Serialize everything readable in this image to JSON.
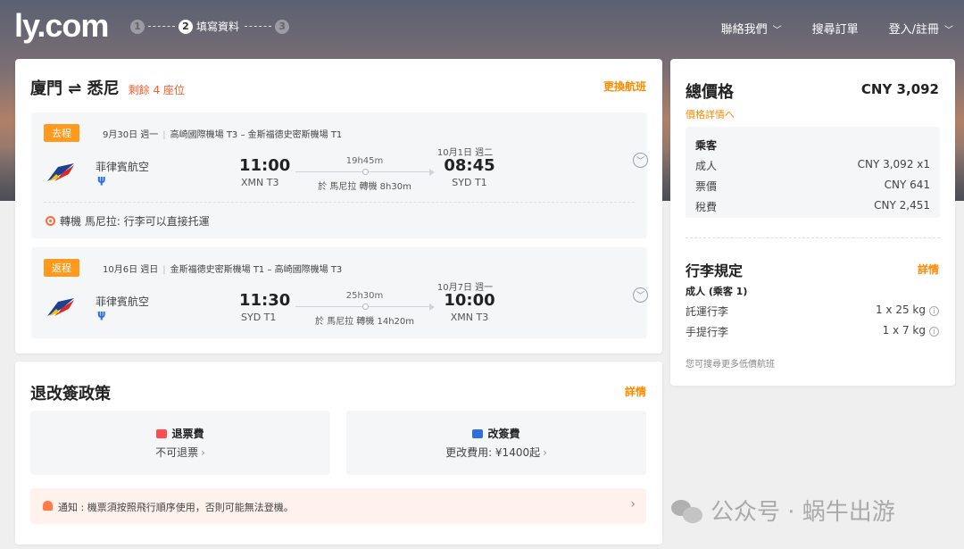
{
  "header": {
    "logo": "ly.com",
    "steps": [
      {
        "num": "1",
        "label": ""
      },
      {
        "num": "2",
        "label": "填寫資料"
      },
      {
        "num": "3",
        "label": ""
      }
    ],
    "nav": {
      "contact": "聯絡我們",
      "search_order": "搜尋訂單",
      "login": "登入/註冊"
    }
  },
  "route": {
    "title": "廈門 ⇌ 悉尼",
    "seats": "剩餘 4 座位",
    "change_link": "更換航班"
  },
  "segments": [
    {
      "tag": "去程",
      "date": "9月30日 週一",
      "airports_line": "高崎國際機場 T3 – 金斯福德史密斯機場 T1",
      "airline": "菲律賓航空",
      "dep_time": "11:00",
      "dep_airport": "XMN T3",
      "duration": "19h45m",
      "transfer": "於 馬尼拉 轉機 8h30m",
      "arr_date": "10月1日 週二",
      "arr_time": "08:45",
      "arr_airport": "SYD T1",
      "baggage_note": "轉機 馬尼拉: 行李可以直接托運"
    },
    {
      "tag": "返程",
      "date": "10月6日 週日",
      "airports_line": "金斯福德史密斯機場 T1 – 高崎國際機場 T3",
      "airline": "菲律賓航空",
      "dep_time": "11:30",
      "dep_airport": "SYD T1",
      "duration": "25h30m",
      "transfer": "於 馬尼拉 轉機 14h20m",
      "arr_date": "10月7日 週一",
      "arr_time": "10:00",
      "arr_airport": "XMN T3"
    }
  ],
  "policy": {
    "title": "退改簽政策",
    "detail_link": "詳情",
    "refund": {
      "label": "退票費",
      "value": "不可退票"
    },
    "change": {
      "label": "改簽費",
      "value": "更改費用: ¥1400起"
    },
    "notice": "通知 : 機票須按照飛行順序使用，否則可能無法登機。"
  },
  "price": {
    "total_label": "總價格",
    "total_value": "CNY 3,092",
    "detail_link": "價格詳情へ",
    "passenger_header": "乘客",
    "rows": [
      {
        "label": "成人",
        "value": "CNY 3,092 x1"
      },
      {
        "label": "票價",
        "value": "CNY 641"
      },
      {
        "label": "稅費",
        "value": "CNY 2,451"
      }
    ]
  },
  "baggage": {
    "title": "行李規定",
    "detail_link": "詳情",
    "subtitle": "成人 (乘客 1)",
    "rows": [
      {
        "label": "託運行李",
        "value": "1 x 25 kg"
      },
      {
        "label": "手提行李",
        "value": "1 x 7 kg"
      }
    ],
    "footnote": "您可搜尋更多低價航班"
  },
  "watermark": "公众号 · 蜗牛出游",
  "icons": {
    "airline_logo": "philippine-airlines-logo",
    "meal": "meal-icon",
    "pin": "pin-icon",
    "expand": "chevron-down-circle-icon",
    "bell": "bell-icon",
    "info": "info-icon"
  },
  "colors": {
    "accent": "#ff8a00",
    "tag": "#ff9a1f",
    "seats": "#ff5a2b"
  }
}
